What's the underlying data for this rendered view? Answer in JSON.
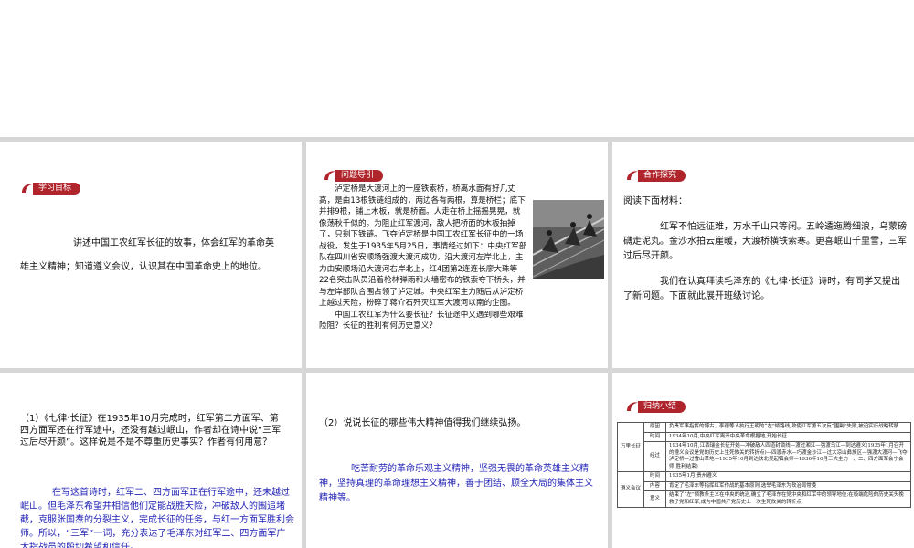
{
  "colors": {
    "badge": "#b0242b",
    "answer_text": "#1f1fb4",
    "background": "#d6d6d6"
  },
  "slide1": {
    "badge": "学习目标",
    "text1": "讲述中国工农红军长征的故事，体会红军的革命英",
    "text2": "雄主义精神；知道遵义会议，认识其在中国革命史上的地位。"
  },
  "slide2": {
    "badge": "问题导引",
    "para1": "泸定桥是大渡河上的一座铁索桥，桥离水面有好几丈高，是由13根铁链组成的，两边各有两根，算是桥栏；底下并排9根，铺上木板，就是桥面。人走在桥上摇摇晃晃，就像荡秋千似的。为阻止红军渡河，敌人把桥面的木板抽掉了，只剩下铁链。飞夺泸定桥是中国工农红军长征中的一场战役，发生于1935年5月25日，事情经过如下：中央红军部队在四川省安顺场强渡大渡河成功，沿大渡河左岸北上，主力由安顺场沿大渡河右岸北上，红4团第2连连长廖大珠等22名突击队员沿着枪林弹雨和火墙密布的铁索夺下桥头，并与左岸部队合围占领了泸定城。中央红军主力随后从泸定桥上越过天险，粉碎了蒋介石歼灭红军大渡河以南的企图。",
    "para2": "中国工农红军为什么要长征？长征途中又遇到哪些艰难险阻？长征的胜利有何历史意义？"
  },
  "slide3": {
    "badge": "合作探究",
    "intro": "阅读下面材料：",
    "poem": "红军不怕远征难，万水千山只等闲。五岭逶迤腾细浪，乌蒙磅礴走泥丸。金沙水拍云崖暖，大渡桥横铁索寒。更喜岷山千里雪，三军过后尽开颜。",
    "para": "我们在认真拜读毛泽东的《七律·长征》诗时，有同学又提出了新问题。下面就此展开班级讨论。"
  },
  "slide4": {
    "question": "（1）《七律·长征》在1935年10月完成时，红军第二方面军、第四方面军还在行军途中，还没有越过岷山，作者却在诗中说“三军过后尽开颜”。这样说是不是不尊重历史事实？作者有何用意？",
    "answer": "在写这首诗时，红军二、四方面军正在行军途中，还未越过岷山。但毛泽东希望并相信他们定能战胜天险，冲破敌人的围追堵截，克服张国焘的分裂主义，完成长征的任务，与红一方面军胜利会师。所以，“三军”一词，充分表达了毛泽东对红军二、四方面军广大指战员的殷切希望和信任。"
  },
  "slide5": {
    "question": "（2）说说长征的哪些伟大精神值得我们继续弘扬。",
    "answer": "吃苦耐劳的革命乐观主义精神，坚强无畏的革命英雄主义精神，坚持真理的革命理想主义精神，善于团结、顾全大局的集体主义精神等。"
  },
  "slide6": {
    "badge": "归纳小结",
    "group1": "万里长征",
    "group2": "遵义会议",
    "rows": [
      {
        "key": "原因",
        "value": "负责军事指挥的博古、李德等人执行王明的“左”倾路线,致使红军第五次反“围剿”失败,被迫实行战略转移"
      },
      {
        "key": "时间",
        "value": "1934年10月,中央红军离开中央革命根据地,开始长征"
      },
      {
        "key": "经过",
        "value": "1934年10月,江西瑞金长征开始—冲破敌人四道封锁线—渡过湘江—强渡乌江—到达遵义(1935年1月召开的遵义会议是党的历史上生死攸关的转折点)—四渡赤水—巧渡金沙江—过大凉山彝族区—强渡大渡河—飞夺泸定桥—过雪山草地—1935年10月到达陕北吴起镇会师—1936年10月三大主力一、二、四方面军会宁会师(胜利结束)"
      },
      {
        "key": "时间",
        "value": "1935年1月,贵州遵义"
      },
      {
        "key": "内容",
        "value": "肯定了毛泽东等指挥红军作战的基本原则,选举毛泽东为政治局常委"
      },
      {
        "key": "意义",
        "value": "结束了“左”倾教条主义在中央的统治,确立了毛泽东在党中央和红军中的领导地位;在极端危险的历史关头挽救了党和红军,成为中国共产党历史上一次生死攸关的转折点"
      }
    ]
  }
}
